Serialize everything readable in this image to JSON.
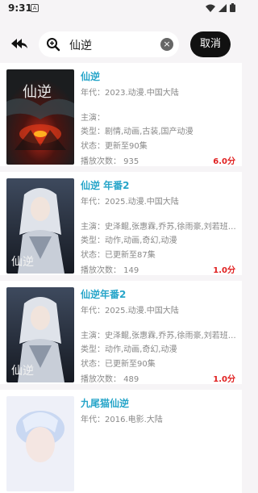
{
  "status_bar": {
    "time": "9:31",
    "notification_glyph": "A"
  },
  "search": {
    "query": "仙逆",
    "cancel_label": "取消",
    "clear_glyph": "×"
  },
  "results": [
    {
      "title": "仙逆",
      "year_line": "年代：2023.动漫.中国大陆",
      "cast_line": "主演：",
      "genre_line": "类型：剧情,动画,古装,国产动漫",
      "status_line": "状态：更新至90集",
      "plays_line": "播放次数： 935",
      "rating": "6.0分",
      "poster_text": "仙逆"
    },
    {
      "title": "仙逆 年番2",
      "year_line": "年代：2025.动漫.中国大陆",
      "cast_line": "主演：史泽鲲,张惠霖,乔苏,徐雨豪,刘若班,…",
      "genre_line": "类型：动作,动画,奇幻,动漫",
      "status_line": "状态：已更新至87集",
      "plays_line": "播放次数： 149",
      "rating": "1.0分",
      "poster_text": "仙逆"
    },
    {
      "title": "仙逆年番2",
      "year_line": "年代：2025.动漫.中国大陆",
      "cast_line": "主演：史泽鲲,张惠霖,乔苏,徐雨豪,刘若班,…",
      "genre_line": "类型：动作,动画,奇幻,动漫",
      "status_line": "状态：已更新至90集",
      "plays_line": "播放次数： 489",
      "rating": "1.0分",
      "poster_text": "仙逆"
    },
    {
      "title": "九尾猫仙逆",
      "year_line": "年代：2016.电影.大陆"
    }
  ],
  "icons": {
    "back": "double-back-arrow-icon",
    "search": "search-icon",
    "clear": "clear-icon"
  },
  "colors": {
    "title": "#27a5c9",
    "rating": "#e02020",
    "cancel_bg": "#111111"
  }
}
